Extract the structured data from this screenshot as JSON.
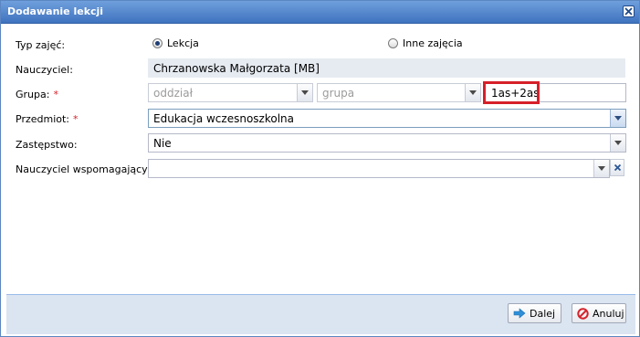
{
  "dialog": {
    "title": "Dodawanie lekcji"
  },
  "form": {
    "typ_zajec": {
      "label": "Typ zajęć:",
      "options": [
        "Lekcja",
        "Inne zajęcia"
      ],
      "selected": "Lekcja"
    },
    "nauczyciel": {
      "label": "Nauczyciel:",
      "value": "Chrzanowska Małgorzata [MB]"
    },
    "grupa": {
      "label": "Grupa:",
      "required_mark": "*",
      "oddzial_placeholder": "oddział",
      "grupa_placeholder": "grupa",
      "value": "1as+2as"
    },
    "przedmiot": {
      "label": "Przedmiot:",
      "required_mark": "*",
      "value": "Edukacja wczesnoszkolna"
    },
    "zastepstwo": {
      "label": "Zastępstwo:",
      "value": "Nie"
    },
    "nauczyciel_wspomagajacy": {
      "label": "Nauczyciel wspomagający:",
      "value": ""
    }
  },
  "buttons": {
    "next": "Dalej",
    "cancel": "Anuluj"
  },
  "colors": {
    "titlebar": "#3f73bf",
    "required": "#d4232b",
    "highlight": "#d6202a",
    "footer": "#dbe4f1"
  },
  "icons": {
    "close": "close-icon",
    "dropdown": "chevron-down-icon",
    "clear": "x-icon",
    "next": "arrow-right-icon",
    "cancel": "cancel-icon"
  }
}
